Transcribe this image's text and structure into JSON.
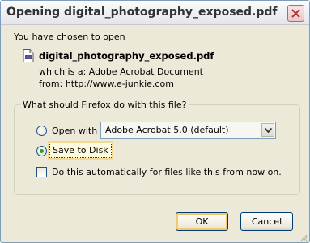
{
  "window": {
    "title": "Opening digital_photography_exposed.pdf"
  },
  "intro": "You have chosen to open",
  "file": {
    "name": "digital_photography_exposed.pdf",
    "icon": "pdf-file-icon",
    "type_label": "which is a:",
    "type_value": "Adobe Acrobat Document",
    "from_label": "from:",
    "from_value": "http://www.e-junkie.com"
  },
  "action_group": {
    "legend": "What should Firefox do with this file?",
    "open_with_label": "Open with",
    "open_with_app": "Adobe Acrobat 5.0 (default)",
    "save_label": "Save to Disk",
    "selected": "save",
    "auto_label": "Do this automatically for files like this from now on.",
    "auto_checked": false
  },
  "buttons": {
    "ok": "OK",
    "cancel": "Cancel"
  }
}
